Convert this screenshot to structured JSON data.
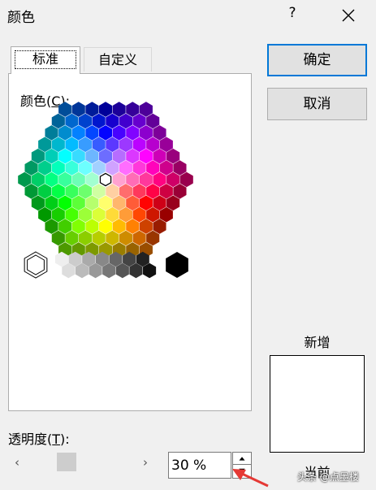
{
  "window": {
    "title": "颜色",
    "help_label": "?",
    "close_icon": "close-icon"
  },
  "tabs": [
    {
      "label": "标准",
      "selected": true
    },
    {
      "label": "自定义",
      "selected": false
    }
  ],
  "palette": {
    "label": "颜色(C):",
    "mnemonic": "C",
    "selected_color": "#ffffff"
  },
  "buttons": {
    "ok_label": "确定",
    "cancel_label": "取消"
  },
  "preview": {
    "new_label": "新增",
    "current_label": "当前",
    "new_color": "#ffffff"
  },
  "transparency": {
    "label": "透明度(T):",
    "mnemonic": "T",
    "value_text": "30 %",
    "slider_value": 0.3,
    "left_arrow": "‹",
    "right_arrow": "›"
  },
  "watermark": "头条 @点墨楼",
  "colors": {
    "accent": "#0078d7",
    "annotation_arrow": "#e53935"
  }
}
